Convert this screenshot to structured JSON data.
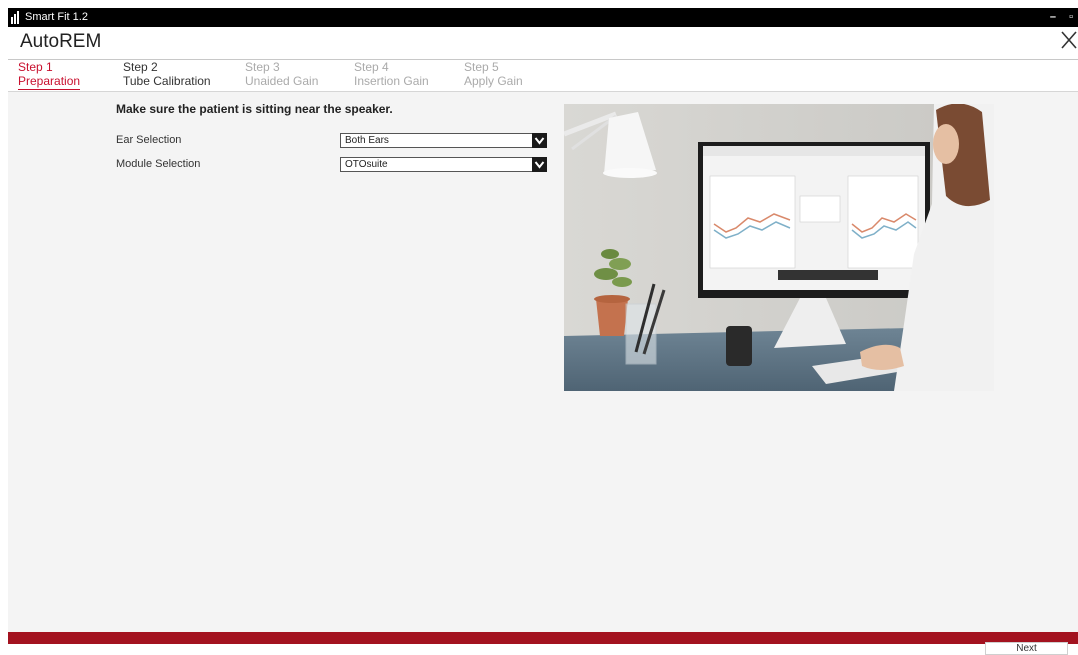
{
  "window": {
    "app_title": "Smart Fit 1.2",
    "minimize_glyph": "–",
    "restore_glyph": "▫"
  },
  "header": {
    "title": "AutoREM",
    "close_glyph": "✕"
  },
  "steps": [
    {
      "num": "Step 1",
      "label": "Preparation",
      "state": "active"
    },
    {
      "num": "Step 2",
      "label": "Tube Calibration",
      "state": "done"
    },
    {
      "num": "Step 3",
      "label": "Unaided Gain",
      "state": "pending"
    },
    {
      "num": "Step 4",
      "label": "Insertion Gain",
      "state": "pending"
    },
    {
      "num": "Step 5",
      "label": "Apply Gain",
      "state": "pending"
    }
  ],
  "main": {
    "instruction": "Make sure the patient is sitting near the speaker.",
    "ear_selection": {
      "label": "Ear Selection",
      "value": "Both Ears"
    },
    "module_selection": {
      "label": "Module Selection",
      "value": "OTOsuite"
    }
  },
  "footer": {
    "next_label": "Next"
  },
  "colors": {
    "accent": "#c8102e",
    "bottom_bar": "#a3121f",
    "titlebar": "#000000"
  }
}
